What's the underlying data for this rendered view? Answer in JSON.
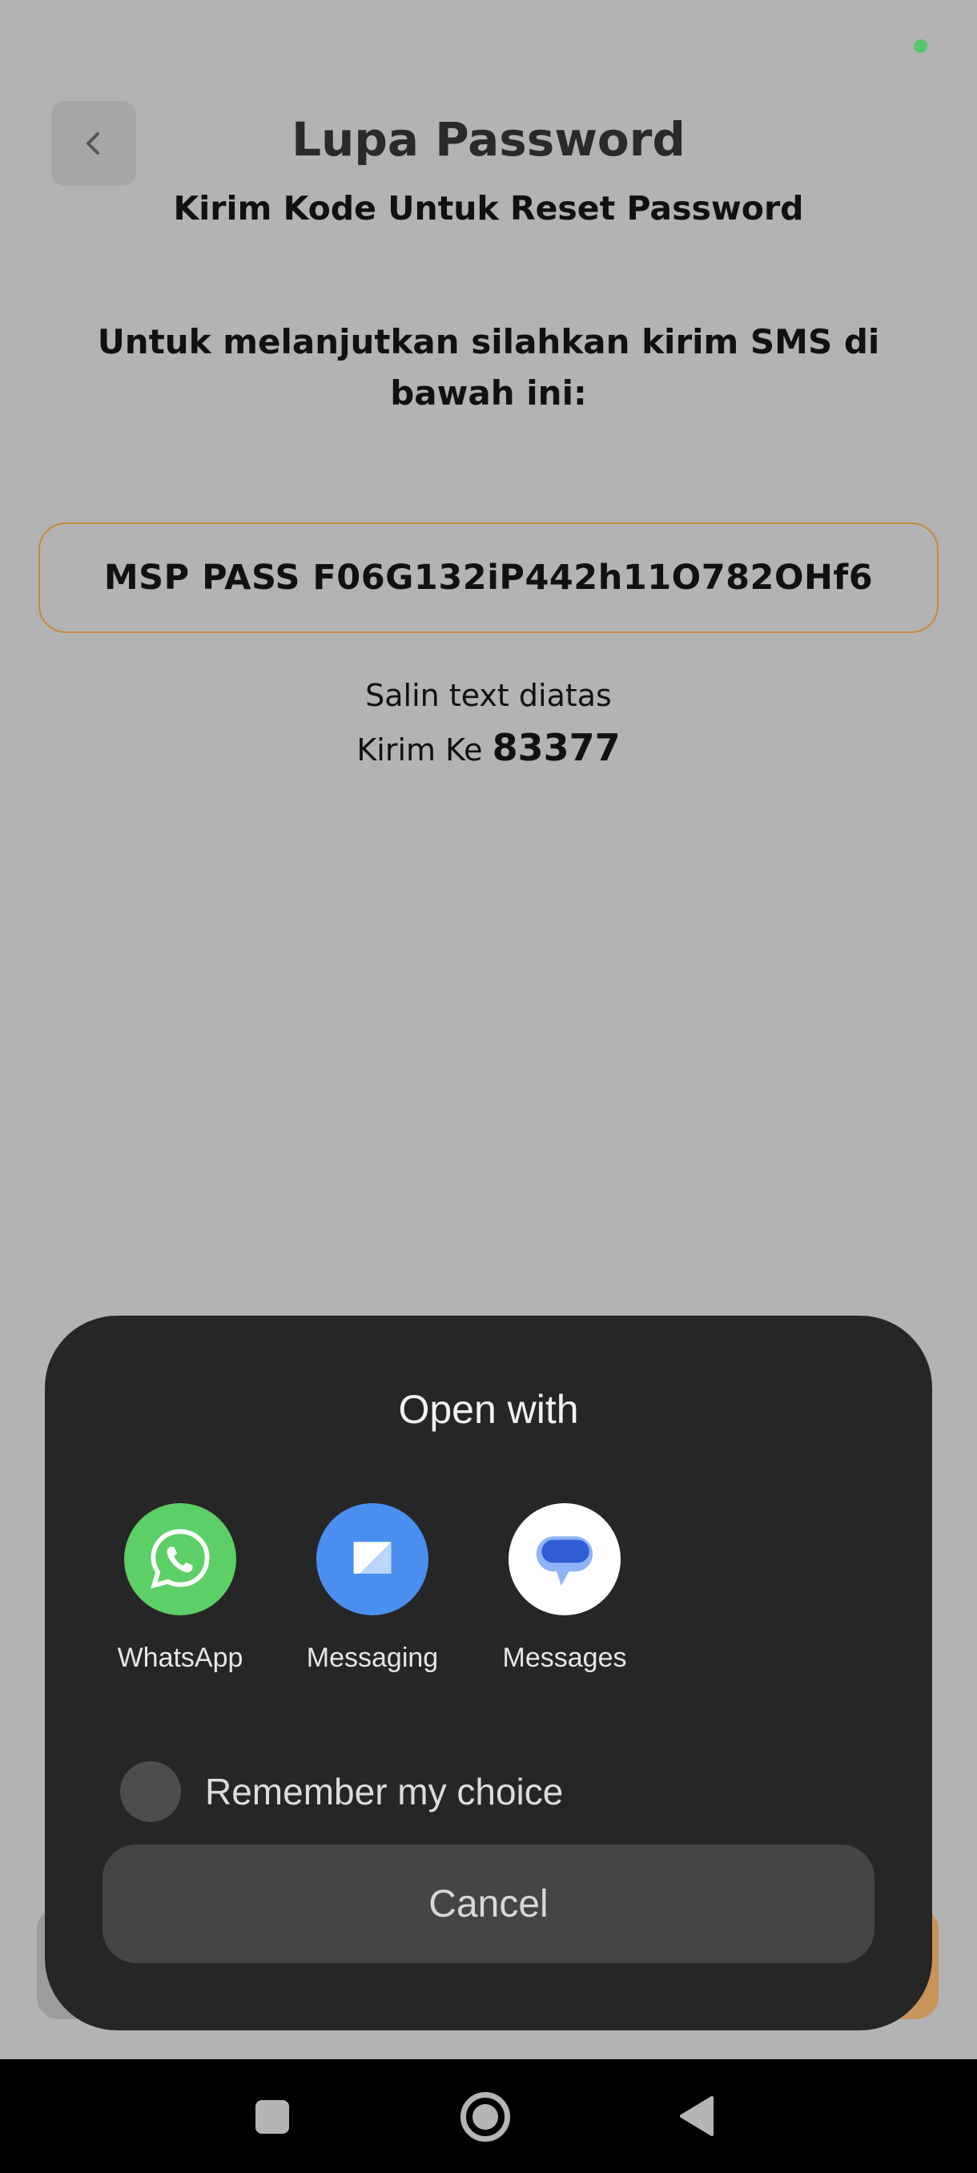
{
  "header": {
    "title": "Lupa Password",
    "subtitle": "Kirim Kode Untuk Reset Password"
  },
  "main": {
    "instruction": "Untuk melanjutkan silahkan kirim SMS di bawah ini:",
    "sms_code": "MSP PASS F06G132iP442h11O782OHf6",
    "copy_hint": "Salin text diatas",
    "send_to_prefix": "Kirim Ke",
    "send_to_number": "83377",
    "accent_color": "#c9893a"
  },
  "sheet": {
    "title": "Open with",
    "apps": [
      {
        "label": "WhatsApp",
        "icon": "whatsapp-icon",
        "color": "#5ccf66"
      },
      {
        "label": "Messaging",
        "icon": "messaging-icon",
        "color": "#4a8ff0"
      },
      {
        "label": "Messages",
        "icon": "messages-icon",
        "color": "#ffffff"
      }
    ],
    "remember_label": "Remember my choice",
    "cancel_label": "Cancel"
  }
}
